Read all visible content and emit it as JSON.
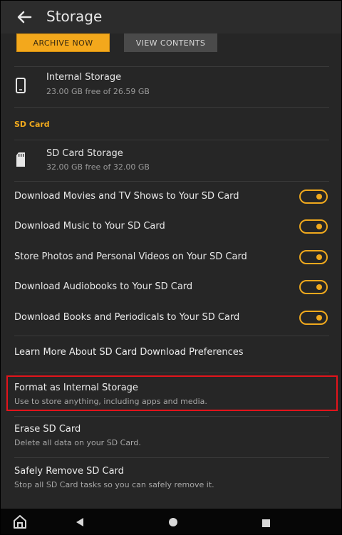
{
  "header": {
    "title": "Storage",
    "back_icon": "arrow-left-icon"
  },
  "actions": {
    "archive_label": "ARCHIVE NOW",
    "view_label": "VIEW CONTENTS"
  },
  "internal_storage": {
    "icon": "phone-icon",
    "title": "Internal Storage",
    "subtitle": "23.00 GB free of 26.59 GB"
  },
  "sd_section": {
    "heading": "SD Card"
  },
  "sd_storage": {
    "icon": "sd-card-icon",
    "title": "SD Card Storage",
    "subtitle": "32.00 GB free of 32.00 GB"
  },
  "toggles": [
    {
      "label": "Download Movies and TV Shows to Your SD Card",
      "on": true
    },
    {
      "label": "Download Music to Your SD Card",
      "on": true
    },
    {
      "label": "Store Photos and Personal Videos on Your SD Card",
      "on": true
    },
    {
      "label": "Download Audiobooks to Your SD Card",
      "on": true
    },
    {
      "label": "Download Books and Periodicals to Your SD Card",
      "on": true
    }
  ],
  "learn_more": {
    "label": "Learn More About SD Card Download Preferences"
  },
  "options": [
    {
      "title": "Format as Internal Storage",
      "subtitle": "Use to store anything, including apps and media."
    },
    {
      "title": "Erase SD Card",
      "subtitle": "Delete all data on your SD Card."
    },
    {
      "title": "Safely Remove SD Card",
      "subtitle": "Stop all SD Card tasks so you can safely remove it."
    }
  ],
  "navbar": {
    "items": [
      "home-icon",
      "back-triangle-icon",
      "circle-home-icon",
      "square-recents-icon"
    ]
  },
  "colors": {
    "accent": "#f0a91d",
    "background": "#262626",
    "highlight_border": "#e3141b",
    "navbar": "#060606"
  }
}
